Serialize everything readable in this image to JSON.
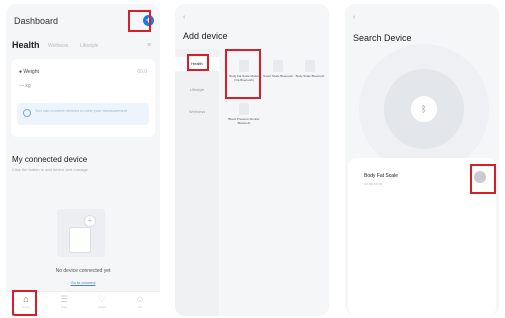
{
  "dashboard": {
    "title": "Dashboard",
    "add_icon": "plus-circle-icon",
    "add_glyph": "+",
    "health_tab": "Health",
    "other_tabs": [
      "Wellness",
      "Lifestyle"
    ],
    "menu_glyph": "≡",
    "weight_label": "● Weight",
    "weight_value": "60.0",
    "weight_unit": "— kg",
    "notice_text": "You can connect devices to view your measurement",
    "connected_title": "My connected device",
    "connected_subtitle": "Click the button to add device and manage",
    "plus_glyph": "+",
    "no_device_text": "No device connected yet",
    "go_connect": "Go to connect",
    "nav": [
      {
        "glyph": "⌂",
        "label": "Home"
      },
      {
        "glyph": "☰",
        "label": "Data"
      },
      {
        "glyph": "♡",
        "label": "Health"
      },
      {
        "glyph": "☺",
        "label": "Me"
      }
    ]
  },
  "add_device": {
    "back_glyph": "‹",
    "title": "Add device",
    "categories": [
      "Health",
      "Lifestyle",
      "Wellness"
    ],
    "active_category": "Health",
    "devices": [
      {
        "name": "Body Fat Scale Model (Via Bluetooth)"
      },
      {
        "name": "Smart Scale Bluetooth"
      },
      {
        "name": "Body Scale Bluetooth"
      },
      {
        "name": "Blood Pressure Monitor Bluetooth"
      }
    ]
  },
  "search_device": {
    "back_glyph": "‹",
    "title": "Search Device",
    "bluetooth_glyph": "ᛒ",
    "found_device_name": "Body Fat Scale",
    "found_device_sub": "XX:XX:XX:XX"
  },
  "colors": {
    "highlight": "#d71e2b",
    "accent": "#1f7ae0"
  }
}
